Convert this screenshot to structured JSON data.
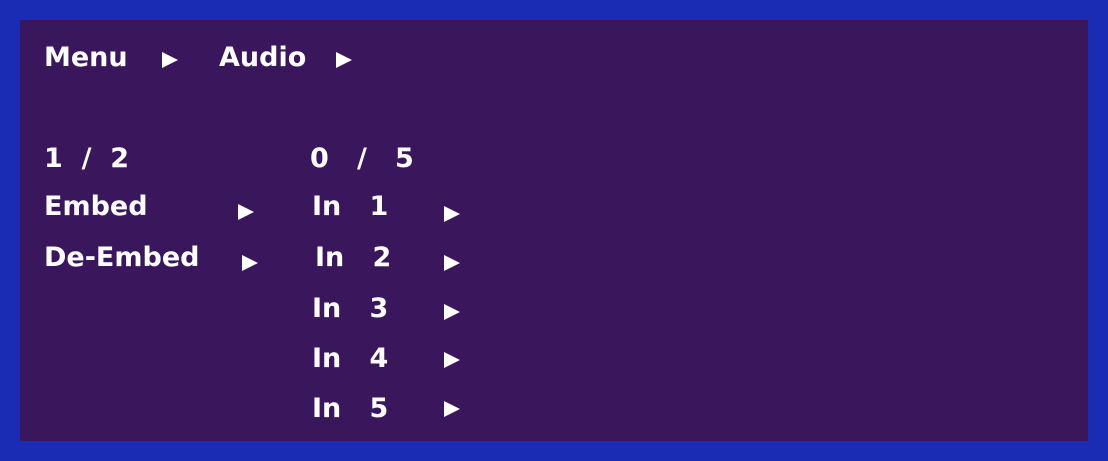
{
  "breadcrumb": {
    "menu": "Menu",
    "audio": "Audio"
  },
  "col1": {
    "page": "1  /  2",
    "items": [
      {
        "label": "Embed"
      },
      {
        "label": "De-Embed"
      }
    ]
  },
  "col2": {
    "page": "0   /   5",
    "items": [
      {
        "label": "In   1"
      },
      {
        "label": "In   2"
      },
      {
        "label": "In   3"
      },
      {
        "label": "In   4"
      },
      {
        "label": "In   5"
      }
    ]
  },
  "icons": {
    "submenu": "right-triangle-arrow-icon"
  },
  "colors": {
    "frame": "#1a2bb4",
    "background": "#3a175d",
    "text": "#ffffff"
  }
}
